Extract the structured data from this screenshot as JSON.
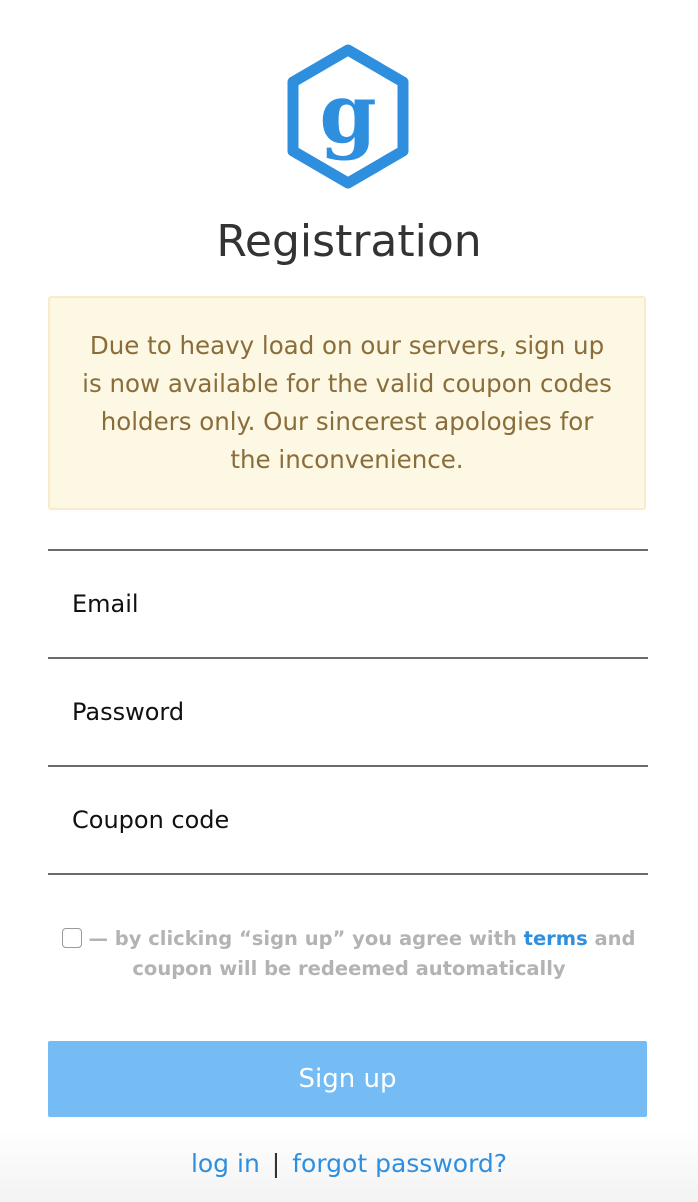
{
  "header": {
    "logo_letter": "g",
    "title": "Registration",
    "brand_color": "#2f8fdf"
  },
  "notice": {
    "text": "Due to heavy load on our servers, sign up is now available for the valid coupon codes holders only. Our sincerest apologies for the inconvenience."
  },
  "form": {
    "email_placeholder": "Email",
    "password_placeholder": "Password",
    "coupon_placeholder": "Coupon code",
    "email_value": "",
    "password_value": "",
    "coupon_value": ""
  },
  "agreement": {
    "checked": false,
    "text_before": "— by clicking “sign up” you agree with ",
    "terms_link": "terms",
    "text_after": " and coupon will be redeemed automatically"
  },
  "actions": {
    "signup_label": "Sign up",
    "login_link": "log in",
    "separator": "|",
    "forgot_link": "forgot password?"
  }
}
